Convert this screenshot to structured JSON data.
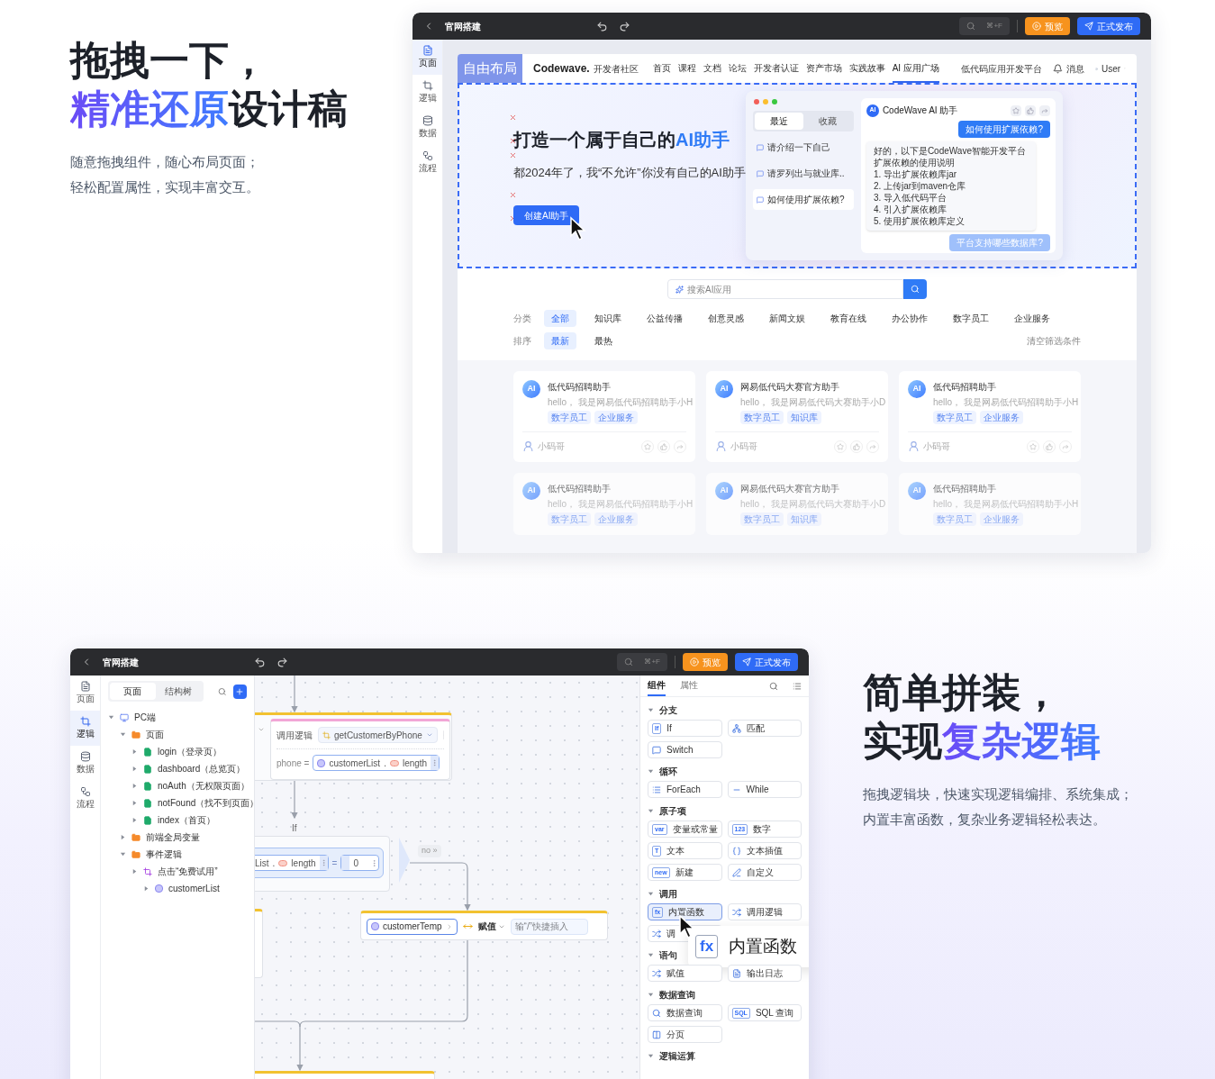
{
  "section1": {
    "title_line1": "拖拽一下，",
    "title_line2": [
      {
        "text": "精准还原",
        "accent": true
      },
      {
        "text": "设计稿",
        "accent": false
      }
    ],
    "description": [
      "随意拖拽组件，随心布局页面；",
      "轻松配置属性，实现丰富交互。"
    ]
  },
  "editor1": {
    "toolbar": {
      "title": "官网搭建",
      "search_shortcut": "⌘+F",
      "preview": "预览",
      "publish": "正式发布"
    },
    "sidebar": [
      {
        "label": "页面",
        "kind": "page",
        "selected": true
      },
      {
        "label": "逻辑",
        "kind": "logic",
        "selected": false
      },
      {
        "label": "数据",
        "kind": "data",
        "selected": false
      },
      {
        "label": "流程",
        "kind": "flow",
        "selected": false
      }
    ],
    "layout_badge": "自由布局",
    "site_nav": {
      "logo": "Codewave.",
      "logo_caption": "开发者社区",
      "links": [
        {
          "label": "首页",
          "selected": false
        },
        {
          "label": "课程",
          "selected": false
        },
        {
          "label": "文档",
          "selected": false
        },
        {
          "label": "论坛",
          "selected": false
        },
        {
          "label": "开发者认证",
          "selected": false
        },
        {
          "label": "资产市场",
          "selected": false
        },
        {
          "label": "实践故事",
          "selected": false
        },
        {
          "label": "AI 应用广场",
          "selected": true
        }
      ],
      "platform_link": "低代码应用开发平台",
      "messages": "消息",
      "user": "User"
    },
    "hero": {
      "title": [
        {
          "text": "打造一个属于自己的",
          "accent": false
        },
        {
          "text": "AI助手",
          "accent": true
        }
      ],
      "subtitle": "都2024年了，我“不允许”你没有自己的AI助手",
      "button": "创建AI助手"
    },
    "chat": {
      "tabs": [
        {
          "label": "最近",
          "selected": true
        },
        {
          "label": "收藏",
          "selected": false
        }
      ],
      "conversations": [
        {
          "text": "请介绍一下自己",
          "selected": false
        },
        {
          "text": "请罗列出与就业库..",
          "selected": false
        },
        {
          "text": "如何使用扩展依赖?",
          "selected": true
        }
      ],
      "assistant": {
        "badge": "AI",
        "name": "CodeWave AI 助手"
      },
      "question": "如何使用扩展依赖?",
      "answer_intro": "好的，以下是CodeWave智能开发平台扩展依赖的使用说明",
      "answer_steps": [
        "1. 导出扩展依赖库jar",
        "2. 上传jar到maven仓库",
        "3. 导入低代码平台",
        "4. 引入扩展依赖库",
        "5. 使用扩展依赖库定义"
      ],
      "suggestion": "平台支持哪些数据库?"
    },
    "search": {
      "placeholder": "搜索AI应用"
    },
    "filters": [
      {
        "label": "分类",
        "options": [
          {
            "label": "全部",
            "selected": true
          },
          {
            "label": "知识库",
            "selected": false
          },
          {
            "label": "公益传播",
            "selected": false
          },
          {
            "label": "创意灵感",
            "selected": false
          },
          {
            "label": "新闻文娱",
            "selected": false
          },
          {
            "label": "教育在线",
            "selected": false
          },
          {
            "label": "办公协作",
            "selected": false
          },
          {
            "label": "数字员工",
            "selected": false
          },
          {
            "label": "企业服务",
            "selected": false
          }
        ]
      },
      {
        "label": "排序",
        "options": [
          {
            "label": "最新",
            "selected": true
          },
          {
            "label": "最热",
            "selected": false
          }
        ]
      }
    ],
    "clear_filters": "清空筛选条件",
    "cards": [
      {
        "badge": "AI",
        "title": "低代码招聘助手",
        "description": "hello，  我是网易低代码招聘助手小H",
        "tags": [
          "数字员工",
          "企业服务"
        ],
        "author": "小码哥",
        "faded": false
      },
      {
        "badge": "AI",
        "title": "网易低代码大赛官方助手",
        "description": "hello，  我是网易低代码大赛助手小D",
        "tags": [
          "数字员工",
          "知识库"
        ],
        "author": "小码哥",
        "faded": false
      },
      {
        "badge": "AI",
        "title": "低代码招聘助手",
        "description": "hello，  我是网易低代码招聘助手小H",
        "tags": [
          "数字员工",
          "企业服务"
        ],
        "author": "小码哥",
        "faded": false
      },
      {
        "badge": "AI",
        "title": "低代码招聘助手",
        "description": "hello，  我是网易低代码招聘助手小H",
        "tags": [
          "数字员工",
          "企业服务"
        ],
        "faded": true
      },
      {
        "badge": "AI",
        "title": "网易低代码大赛官方助手",
        "description": "hello，  我是网易低代码大赛助手小D",
        "tags": [
          "数字员工",
          "知识库"
        ],
        "faded": true
      },
      {
        "badge": "AI",
        "title": "低代码招聘助手",
        "description": "hello，  我是网易低代码招聘助手小H",
        "tags": [
          "数字员工",
          "企业服务"
        ],
        "faded": true
      }
    ]
  },
  "editor2": {
    "toolbar": {
      "title": "官网搭建",
      "search_shortcut": "⌘+F",
      "preview": "预览",
      "publish": "正式发布"
    },
    "sidebar": [
      {
        "label": "页面",
        "kind": "page",
        "selected": false
      },
      {
        "label": "逻辑",
        "kind": "logic",
        "selected": true
      },
      {
        "label": "数据",
        "kind": "data",
        "selected": false
      },
      {
        "label": "流程",
        "kind": "flow",
        "selected": false
      }
    ],
    "panel_tabs": [
      {
        "label": "页面",
        "selected": true
      },
      {
        "label": "结构树",
        "selected": false
      }
    ],
    "tree": [
      {
        "label": "PC端",
        "kind": "device",
        "expanded": true,
        "children": [
          {
            "label": "页面",
            "kind": "folder",
            "expanded": true,
            "children": [
              {
                "label": "login（登录页）",
                "kind": "page",
                "expanded": false
              },
              {
                "label": "dashboard（总览页）",
                "kind": "page",
                "expanded": false
              },
              {
                "label": "noAuth（无权限页面）",
                "kind": "page",
                "expanded": false
              },
              {
                "label": "notFound（找不到页面）",
                "kind": "page",
                "expanded": false
              },
              {
                "label": "index（首页）",
                "kind": "page",
                "expanded": false
              }
            ]
          },
          {
            "label": "前端全局变量",
            "kind": "folder",
            "expanded": false
          },
          {
            "label": "事件逻辑",
            "kind": "folder",
            "expanded": true,
            "children": [
              {
                "label": "点击“免费试用”",
                "kind": "logic",
                "expanded": false,
                "children": [
                  {
                    "label": "customerList",
                    "kind": "variable",
                    "expanded": false
                  }
                ]
              }
            ]
          }
        ]
      }
    ],
    "flow": {
      "call_node": {
        "label": "调用逻辑",
        "logic": "getCustomerByPhone",
        "param": "phone =",
        "var": "customerList",
        "separator": ".",
        "prop": "length"
      },
      "if_label": "If",
      "if_node": {
        "var": "List",
        "separator": ".",
        "prop": "length",
        "operator": "=",
        "value": "0"
      },
      "no_label": "no »",
      "assign_node": {
        "target": "customerTemp",
        "action": "赋值",
        "placeholder": "输“/”快捷插入"
      }
    },
    "component_tabs": [
      {
        "label": "组件",
        "selected": true
      },
      {
        "label": "属性",
        "selected": false
      }
    ],
    "component_groups": [
      {
        "title": "分支",
        "items": [
          {
            "label": "If",
            "kind": "glyph",
            "glyph": "If",
            "selected": false
          },
          {
            "label": "匹配",
            "kind": "match",
            "selected": false
          },
          {
            "label": "Switch",
            "kind": "switch",
            "selected": false
          }
        ]
      },
      {
        "title": "循环",
        "items": [
          {
            "label": "ForEach",
            "kind": "foreach",
            "selected": false
          },
          {
            "label": "While",
            "kind": "while",
            "selected": false
          }
        ]
      },
      {
        "title": "原子项",
        "items": [
          {
            "label": "变量或常量",
            "kind": "glyph",
            "glyph": "var",
            "selected": false
          },
          {
            "label": "数字",
            "kind": "glyph",
            "glyph": "123",
            "selected": false
          },
          {
            "label": "文本",
            "kind": "glyph",
            "glyph": "T",
            "selected": false
          },
          {
            "label": "文本插值",
            "kind": "interp",
            "selected": false
          },
          {
            "label": "新建",
            "kind": "glyph",
            "glyph": "new",
            "selected": false
          },
          {
            "label": "自定义",
            "kind": "custom",
            "selected": false
          }
        ]
      },
      {
        "title": "调用",
        "items": [
          {
            "label": "内置函数",
            "kind": "glyph",
            "glyph": "fx",
            "selected": true
          },
          {
            "label": "调用逻辑",
            "kind": "call",
            "selected": false
          },
          {
            "label": "调",
            "kind": "call",
            "selected": false
          }
        ]
      },
      {
        "title": "语句",
        "items": [
          {
            "label": "赋值",
            "kind": "call",
            "selected": false
          },
          {
            "label": "输出日志",
            "kind": "log",
            "selected": false
          }
        ]
      },
      {
        "title": "数据查询",
        "items": [
          {
            "label": "数据查询",
            "kind": "query",
            "selected": false
          },
          {
            "label": "SQL 查询",
            "kind": "glyph",
            "glyph": "SQL",
            "selected": false
          },
          {
            "label": "分页",
            "kind": "paging",
            "selected": false
          }
        ]
      },
      {
        "title": "逻辑运算"
      }
    ],
    "drag_preview": {
      "glyph": "fx",
      "label": "内置函数"
    }
  },
  "section2": {
    "title_line1": "简单拼装，",
    "title_line2": [
      {
        "text": "实现",
        "accent": false
      },
      {
        "text": "复杂逻辑",
        "accent": true
      }
    ],
    "description": [
      "拖拽逻辑块，快速实现逻辑编排、系统集成；",
      "内置丰富函数，复杂业务逻辑轻松表达。"
    ]
  }
}
